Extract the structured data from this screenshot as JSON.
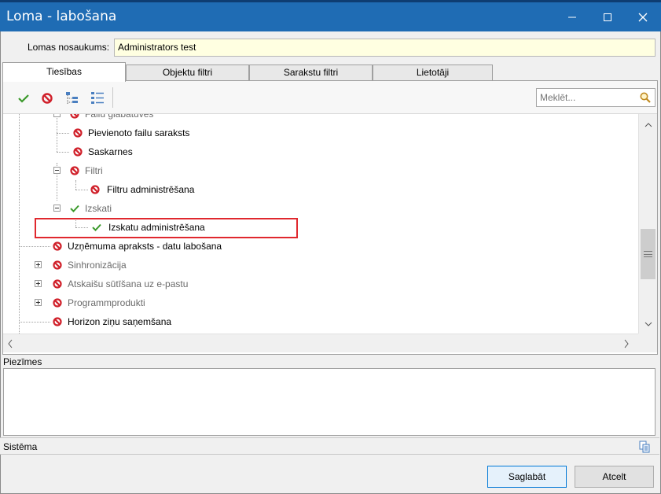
{
  "window": {
    "title": "Loma - labošana",
    "controls": {
      "minimize": "–",
      "maximize": "□",
      "close": "✕"
    }
  },
  "role": {
    "label": "Lomas nosaukums:",
    "value": "Administrators test"
  },
  "tabs": [
    {
      "label": "Tiesības",
      "active": true
    },
    {
      "label": "Objektu filtri",
      "active": false
    },
    {
      "label": "Sarakstu filtri",
      "active": false
    },
    {
      "label": "Lietotāji",
      "active": false
    }
  ],
  "toolbar": {
    "icons": [
      "check-icon",
      "deny-icon",
      "expand-tree-icon",
      "collapse-tree-icon"
    ],
    "search_placeholder": "Meklēt..."
  },
  "tree": {
    "items": [
      {
        "label": "Failu glabātuves",
        "state": "deny",
        "style": "gray",
        "expander": "minus"
      },
      {
        "label": "Pievienoto failu saraksts",
        "state": "deny",
        "style": "normal"
      },
      {
        "label": "Saskarnes",
        "state": "deny",
        "style": "normal"
      },
      {
        "label": "Filtri",
        "state": "deny",
        "style": "gray",
        "expander": "minus"
      },
      {
        "label": "Filtru administrēšana",
        "state": "deny",
        "style": "normal"
      },
      {
        "label": "Izskati",
        "state": "allow",
        "style": "gray",
        "expander": "minus"
      },
      {
        "label": "Izskatu administrēšana",
        "state": "allow",
        "style": "normal",
        "highlighted": true
      },
      {
        "label": "Uzņēmuma apraksts - datu labošana",
        "state": "deny",
        "style": "normal"
      },
      {
        "label": "Sinhronizācija",
        "state": "deny",
        "style": "gray",
        "expander": "plus"
      },
      {
        "label": "Atskaišu sūtīšana uz e-pastu",
        "state": "deny",
        "style": "gray",
        "expander": "plus"
      },
      {
        "label": "Programmprodukti",
        "state": "deny",
        "style": "gray",
        "expander": "plus"
      },
      {
        "label": "Horizon ziņu saņemšana",
        "state": "deny",
        "style": "normal"
      }
    ]
  },
  "notes": {
    "label": "Piezīmes",
    "value": ""
  },
  "status": {
    "label": "Sistēma"
  },
  "buttons": {
    "save": "Saglabāt",
    "cancel": "Atcelt"
  },
  "colors": {
    "titlebar": "#1f6cb4",
    "allow": "#3c9a2c",
    "deny": "#d0202a",
    "highlight": "#e0282e",
    "role_field": "#ffffe1"
  }
}
